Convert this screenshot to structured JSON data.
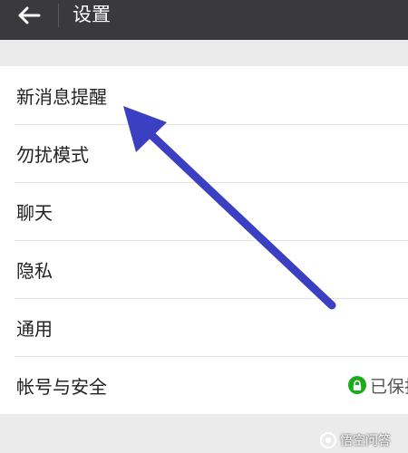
{
  "header": {
    "title": "设置",
    "back_icon": "arrow-left-icon"
  },
  "settings": {
    "items": [
      {
        "label": "新消息提醒"
      },
      {
        "label": "勿扰模式"
      },
      {
        "label": "聊天"
      },
      {
        "label": "隐私"
      },
      {
        "label": "通用"
      },
      {
        "label": "帐号与安全",
        "value": "已保护",
        "value_icon": "lock-icon"
      }
    ]
  },
  "annotation": {
    "color": "#3b3fc1",
    "icon": "pointer-arrow"
  },
  "watermark": {
    "text": "悟空问答",
    "icon": "watermark-logo-icon"
  }
}
